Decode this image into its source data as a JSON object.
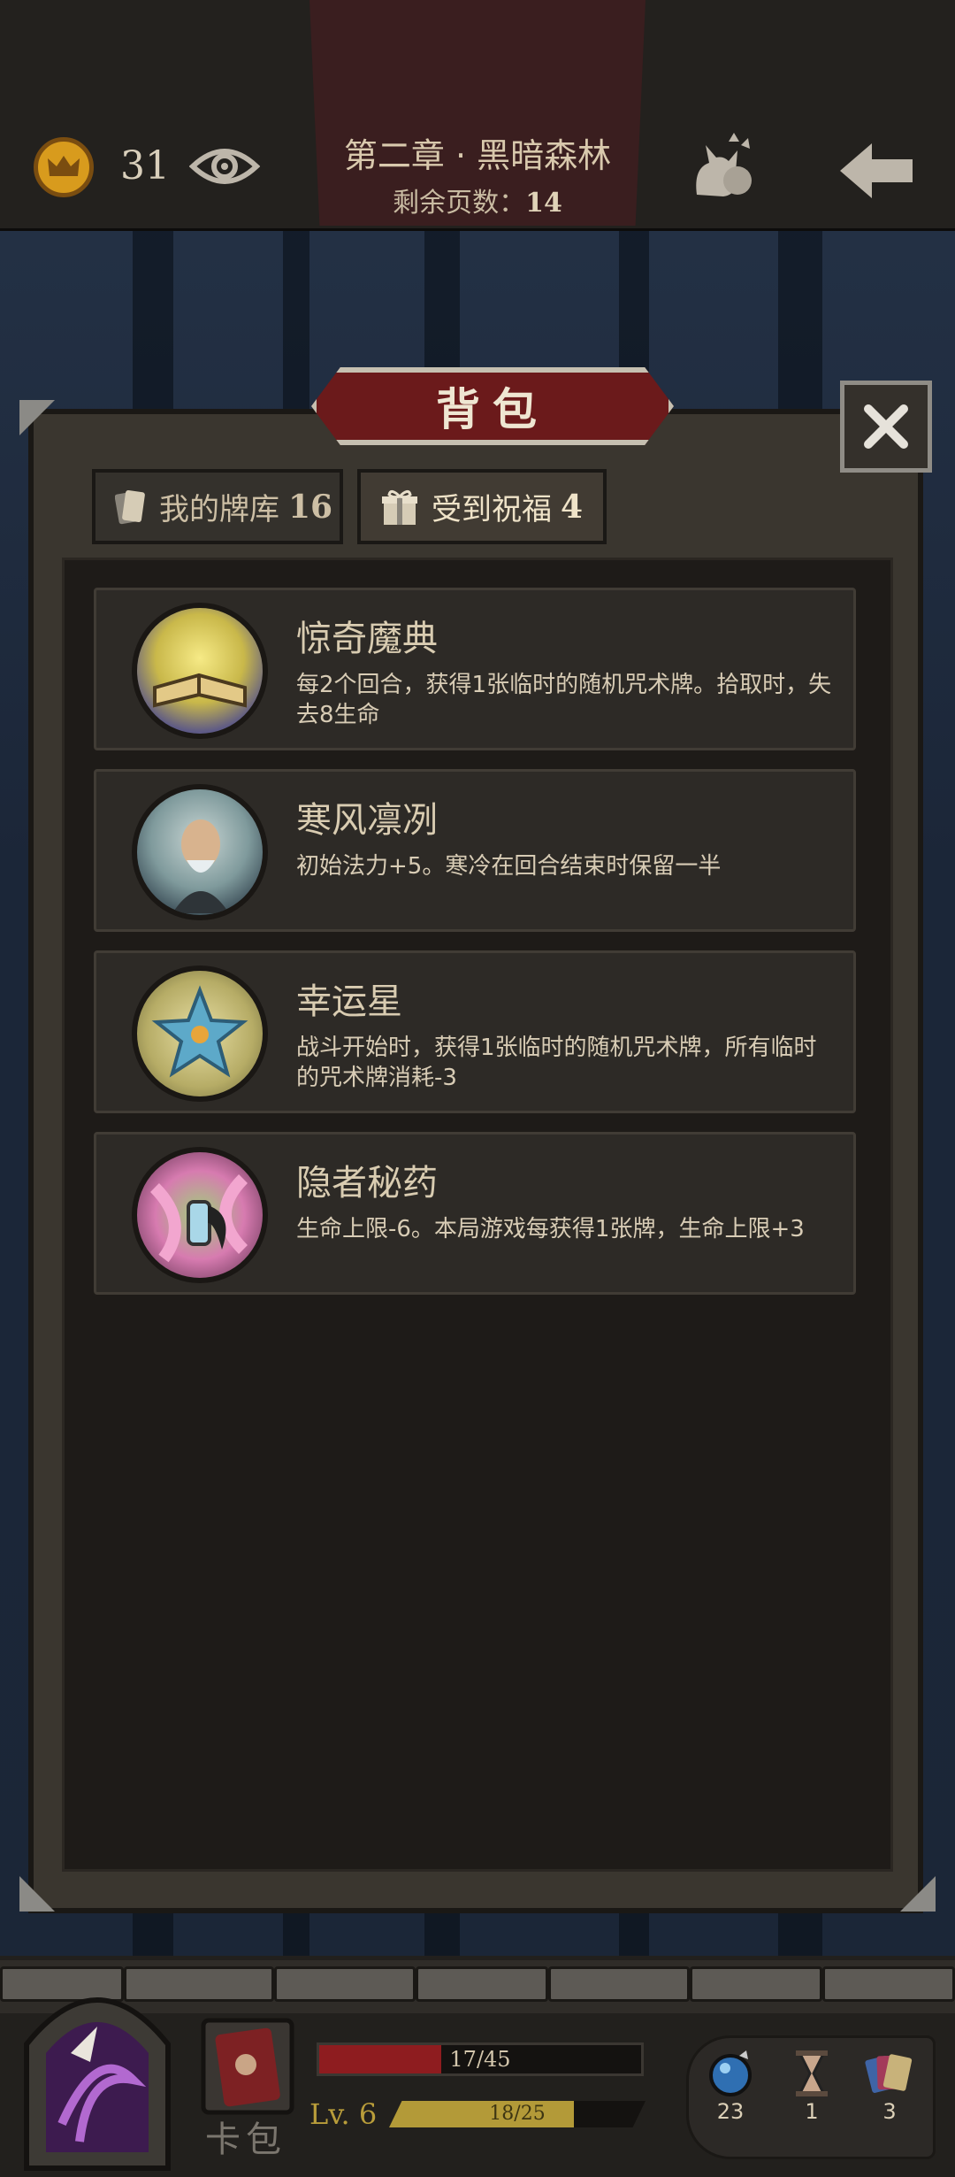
{
  "topbar": {
    "coins": "31",
    "chapter_title": "第二章 · 黑暗森林",
    "pages_left_label": "剩余页数：",
    "pages_left_value": "14"
  },
  "panel": {
    "title": "背包",
    "tabs": [
      {
        "label": "我的牌库",
        "count": "16",
        "active": false
      },
      {
        "label": "受到祝福",
        "count": "4",
        "active": true
      }
    ]
  },
  "blessings": [
    {
      "name": "惊奇魔典",
      "desc": "每2个回合，获得1张临时的随机咒术牌。拾取时，失去8生命",
      "icon": "glowing-book-icon"
    },
    {
      "name": "寒风凛冽",
      "desc": "初始法力+5。寒冷在回合结束时保留一半",
      "icon": "frozen-man-icon"
    },
    {
      "name": "幸运星",
      "desc": "战斗开始时，获得1张临时的随机咒术牌，所有临时的咒术牌消耗-3",
      "icon": "lucky-star-icon"
    },
    {
      "name": "隐者秘药",
      "desc": "生命上限-6。本局游戏每获得1张牌，生命上限+3",
      "icon": "potion-icon"
    }
  ],
  "hud": {
    "cardpack_label": "卡包",
    "hp_text": "17/45",
    "hp_fraction": 0.378,
    "level": "Lv. 6",
    "xp_text": "18/25",
    "xp_fraction": 0.72,
    "resources": [
      {
        "icon": "orb-icon",
        "count": "23"
      },
      {
        "icon": "hourglass-icon",
        "count": "1"
      },
      {
        "icon": "cards-icon",
        "count": "3"
      }
    ]
  },
  "colors": {
    "accent_red": "#6b1a1b",
    "hp_red": "#8e1c1f",
    "xp_gold": "#b39a38"
  }
}
